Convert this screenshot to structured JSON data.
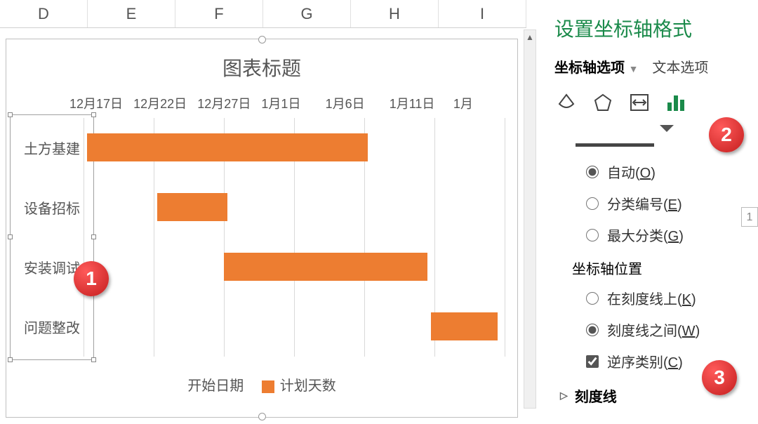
{
  "columns": [
    "D",
    "E",
    "F",
    "G",
    "H",
    "I"
  ],
  "chart": {
    "title": "图表标题",
    "xticks": [
      "12月17日",
      "12月22日",
      "12月27日",
      "1月1日",
      "1月6日",
      "1月11日",
      "1月"
    ],
    "categories": [
      "土方基建",
      "设备招标",
      "安装调试",
      "问题整改"
    ],
    "legend_start": "开始日期",
    "legend_plan": "计划天数"
  },
  "chart_data": {
    "type": "bar",
    "orientation": "horizontal",
    "stacked": true,
    "categories": [
      "土方基建",
      "设备招标",
      "安装调试",
      "问题整改"
    ],
    "x_axis_dates": [
      "12月17日",
      "12月22日",
      "12月27日",
      "1月1日",
      "1月6日",
      "1月11日"
    ],
    "series": [
      {
        "name": "开始日期",
        "values": [
          "12月17日",
          "12月22日",
          "12月27日",
          "1月8日"
        ],
        "fill": "none"
      },
      {
        "name": "计划天数",
        "values": [
          20,
          5,
          14,
          5
        ],
        "fill": "#ed7d31"
      }
    ],
    "title": "图表标题",
    "xlabel": "",
    "ylabel": ""
  },
  "panel": {
    "title": "设置坐标轴格式",
    "tab_axis": "坐标轴选项",
    "tab_text": "文本选项",
    "truncated_header": "······················",
    "opt_auto": "自动(",
    "opt_auto_u": "O",
    "opt_auto_end": ")",
    "opt_catnum": "分类编号(",
    "opt_catnum_u": "E",
    "opt_catnum_end": ")",
    "opt_maxcat": "最大分类(",
    "opt_maxcat_u": "G",
    "opt_maxcat_end": ")",
    "axis_pos_title": "坐标轴位置",
    "opt_ontick": "在刻度线上(",
    "opt_ontick_u": "K",
    "opt_ontick_end": ")",
    "opt_between": "刻度线之间(",
    "opt_between_u": "W",
    "opt_between_end": ")",
    "opt_reverse": "逆序类别(",
    "opt_reverse_u": "C",
    "opt_reverse_end": ")",
    "num_value": "1",
    "section_ticks": "刻度线"
  },
  "badges": {
    "b1": "1",
    "b2": "2",
    "b3": "3"
  }
}
